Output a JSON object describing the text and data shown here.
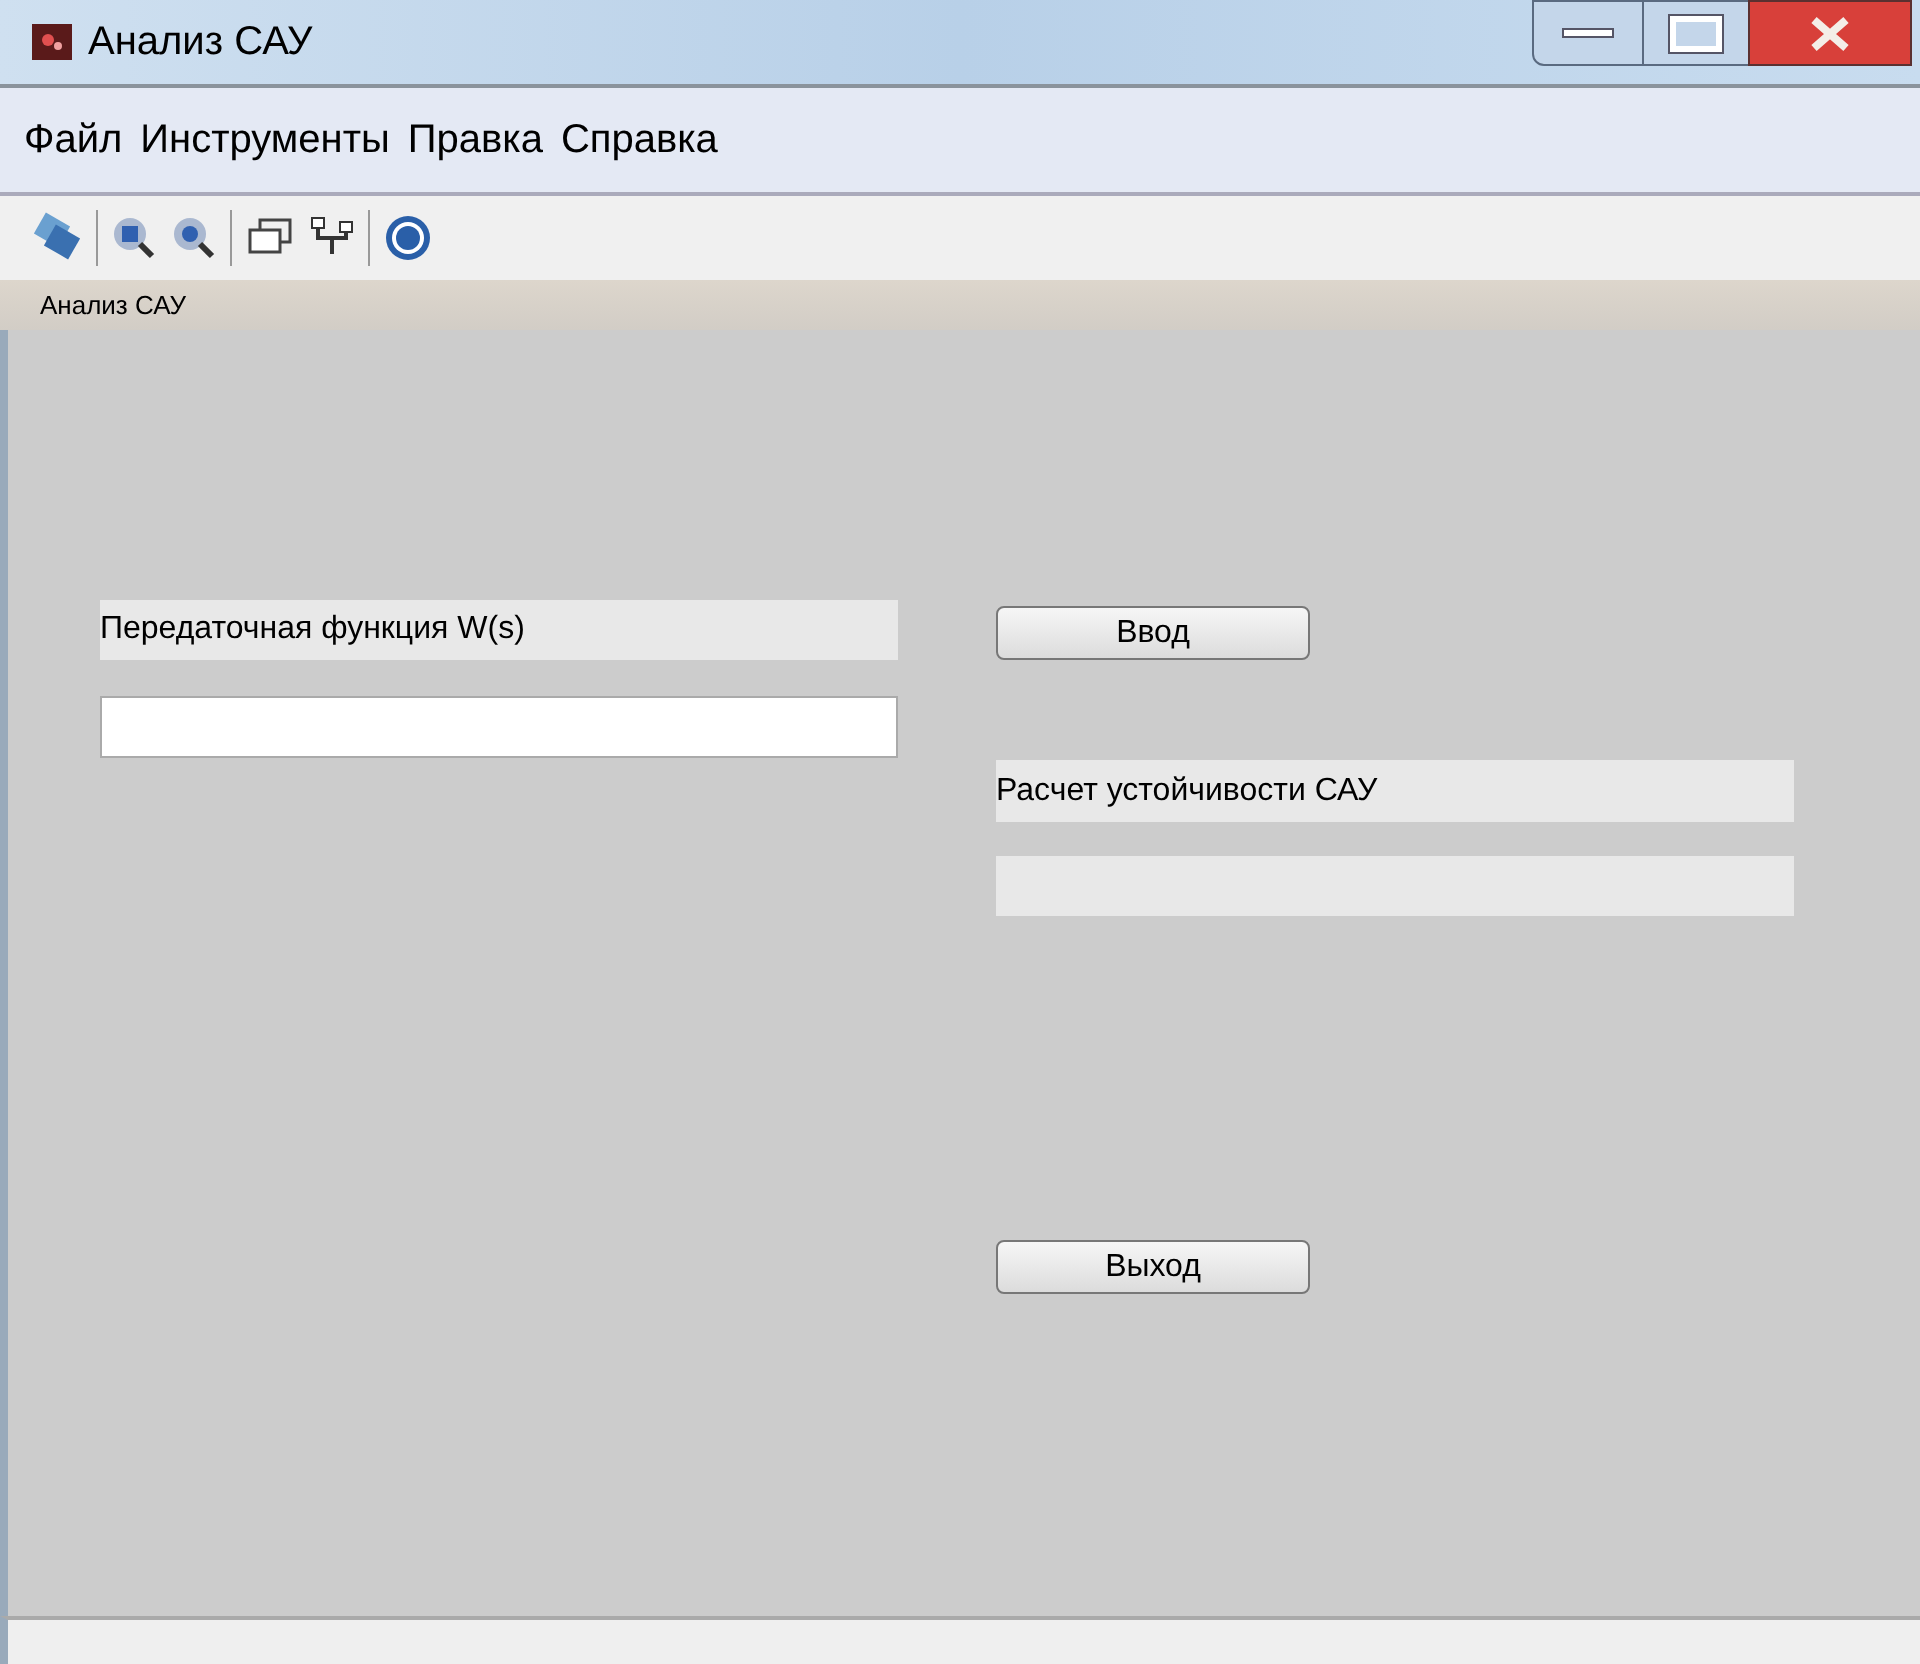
{
  "window": {
    "title": "Анализ САУ"
  },
  "menu": [
    "Файл",
    "Инструменты",
    "Правка",
    "Справка"
  ],
  "panel": {
    "title": "Анализ САУ"
  },
  "form": {
    "input_label": "Передаточная функция W(s)",
    "enter_button": "Ввод",
    "result_label": "Расчет устойчивости САУ",
    "exit_button": "Выход"
  }
}
